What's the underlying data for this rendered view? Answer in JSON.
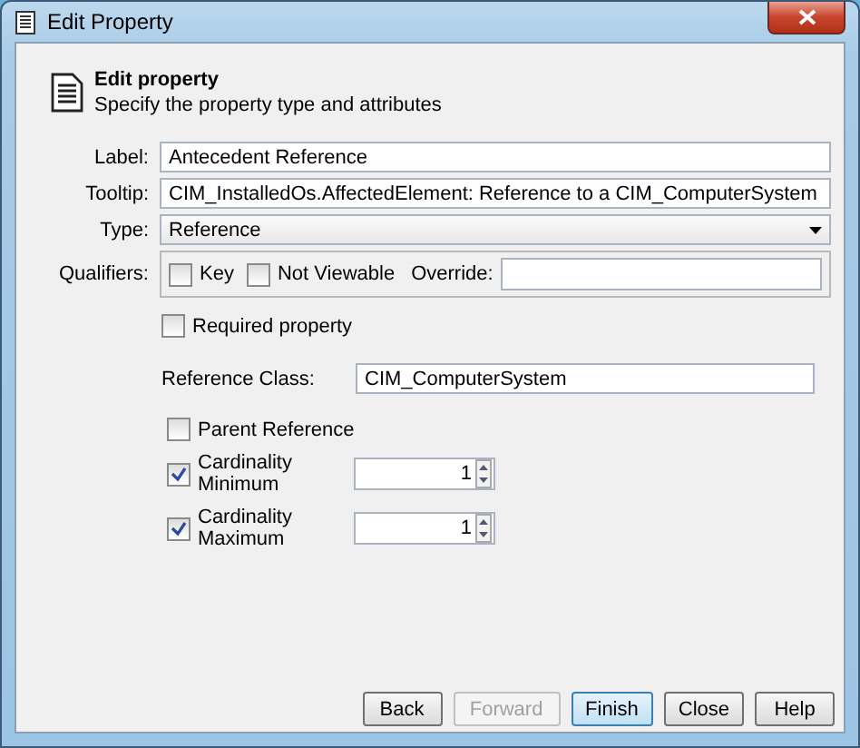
{
  "window": {
    "title": "Edit Property"
  },
  "header": {
    "title": "Edit property",
    "subtitle": "Specify the property type and attributes"
  },
  "fields": [
    {
      "label": "Label:",
      "kind": "text",
      "value": "Antecedent Reference"
    },
    {
      "label": "Tooltip:",
      "kind": "text",
      "value": "CIM_InstalledOs.AffectedElement: Reference to a CIM_ComputerSystem"
    },
    {
      "label": "Type:",
      "kind": "select",
      "value": "Reference"
    }
  ],
  "qualifiers": {
    "label": "Qualifiers:",
    "checks": [
      {
        "label": "Key",
        "checked": false
      },
      {
        "label": "Not Viewable",
        "checked": false
      }
    ],
    "override_label": "Override:"
  },
  "required": {
    "label": "Required property",
    "checked": false
  },
  "reference_class": {
    "label": "Reference Class:",
    "value": "CIM_ComputerSystem"
  },
  "parent_reference": {
    "label": "Parent Reference",
    "checked": false
  },
  "cardinality": [
    {
      "label": "Cardinality Minimum",
      "checked": true,
      "value": "1"
    },
    {
      "label": "Cardinality Maximum",
      "checked": true,
      "value": "1"
    }
  ],
  "buttons": [
    {
      "label": "Back",
      "disabled": false,
      "selected": false
    },
    {
      "label": "Forward",
      "disabled": true,
      "selected": false
    },
    {
      "label": "Finish",
      "disabled": false,
      "selected": true
    },
    {
      "label": "Close",
      "disabled": false,
      "selected": false
    },
    {
      "label": "Help",
      "disabled": false,
      "selected": false
    }
  ]
}
